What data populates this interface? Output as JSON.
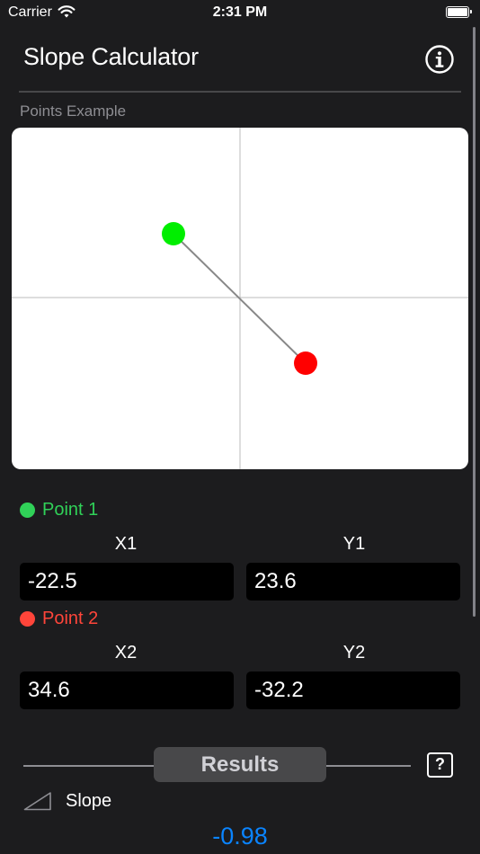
{
  "status_bar": {
    "carrier": "Carrier",
    "time": "2:31 PM",
    "wifi_icon": "wifi-icon",
    "battery_icon": "battery-icon"
  },
  "nav": {
    "title": "Slope Calculator",
    "info_icon": "info-icon"
  },
  "graph": {
    "caption": "Points Example",
    "point1_color": "#00ee00",
    "point2_color": "#ff0000",
    "axis_color": "#bbbbbb",
    "line_color": "#888888"
  },
  "point1": {
    "header": "Point 1",
    "x_label": "X1",
    "y_label": "Y1",
    "x_value": "-22.5",
    "y_value": "23.6",
    "color": "#30d158"
  },
  "point2": {
    "header": "Point 2",
    "x_label": "X2",
    "y_label": "Y2",
    "x_value": "34.6",
    "y_value": "-32.2",
    "color": "#ff453a"
  },
  "results": {
    "title": "Results",
    "help_label": "?"
  },
  "slope": {
    "label": "Slope",
    "value": "-0.98",
    "icon": "slope-icon",
    "value_color": "#0a84ff"
  }
}
